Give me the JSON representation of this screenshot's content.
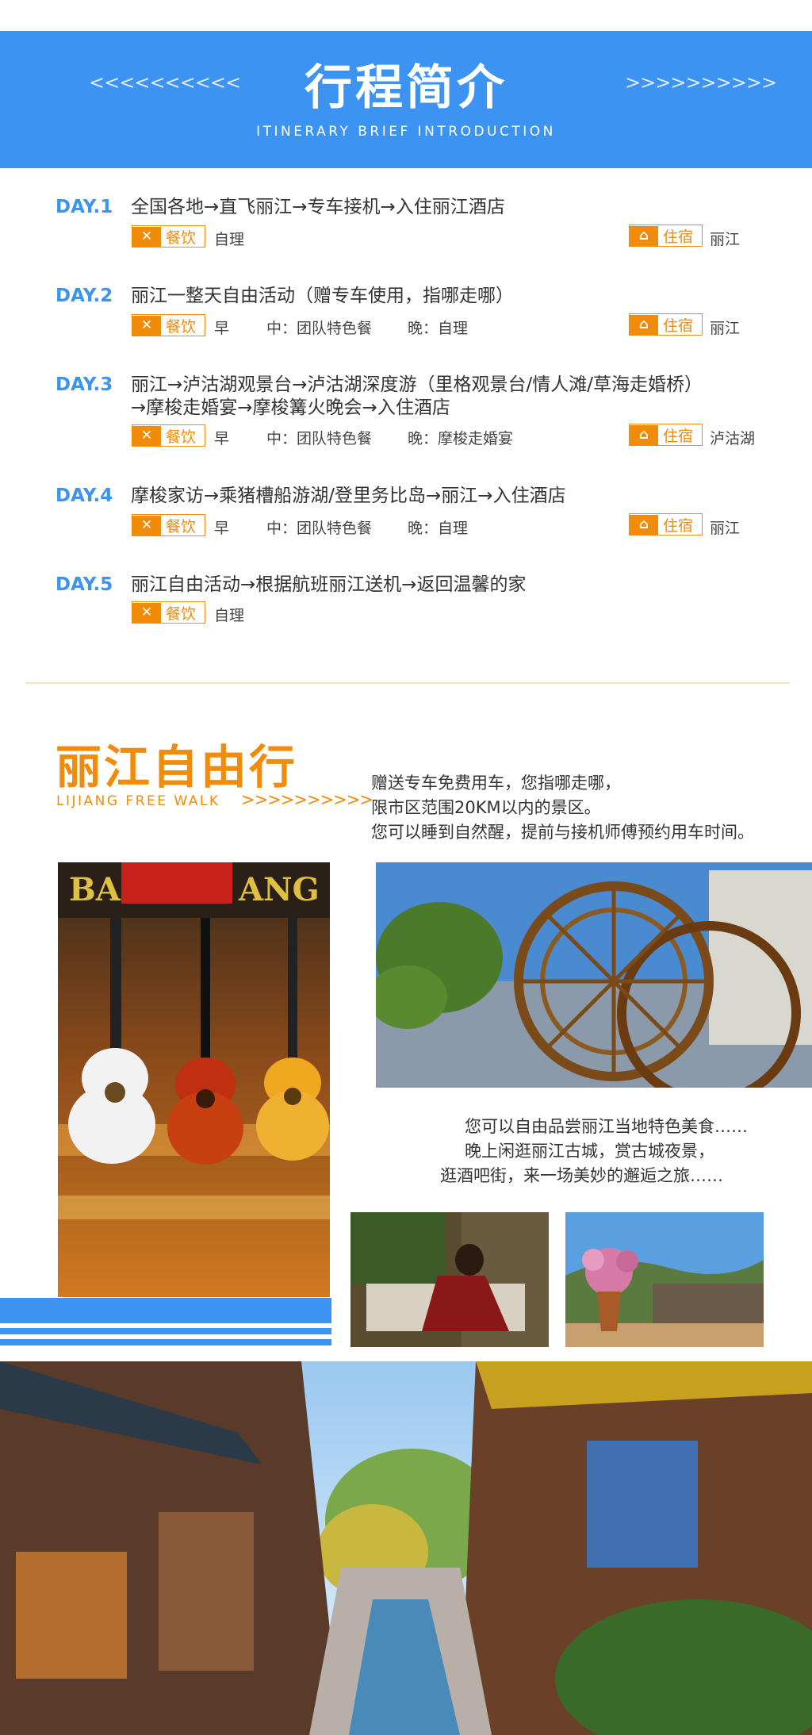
{
  "banner": {
    "title": "行程简介",
    "subtitle": "ITINERARY BRIEF INTRODUCTION",
    "left_arrows": "<<<<<<<<<<",
    "right_arrows": ">>>>>>>>>>"
  },
  "labels": {
    "meal": "餐饮",
    "stay": "住宿"
  },
  "days": [
    {
      "day": "DAY.1",
      "route": [
        "全国各地→直飞丽江→专车接机→入住丽江酒店"
      ],
      "meal": "自理",
      "lunch": "",
      "dinner": "",
      "stay": "丽江"
    },
    {
      "day": "DAY.2",
      "route": [
        "丽江一整天自由活动（赠专车使用，指哪走哪）"
      ],
      "meal": "早",
      "lunch": "中：团队特色餐",
      "dinner": "晚：自理",
      "stay": "丽江"
    },
    {
      "day": "DAY.3",
      "route": [
        "丽江→泸沽湖观景台→泸沽湖深度游（里格观景台/情人滩/草海走婚桥）",
        "→摩梭走婚宴→摩梭篝火晚会→入住酒店"
      ],
      "meal": "早",
      "lunch": "中：团队特色餐",
      "dinner": "晚：摩梭走婚宴",
      "stay": "泸沽湖"
    },
    {
      "day": "DAY.4",
      "route": [
        "摩梭家访→乘猪槽船游湖/登里务比岛→丽江→入住酒店"
      ],
      "meal": "早",
      "lunch": "中：团队特色餐",
      "dinner": "晚：自理",
      "stay": "丽江"
    },
    {
      "day": "DAY.5",
      "route": [
        "丽江自由活动→根据航班丽江送机→返回温馨的家"
      ],
      "meal": "自理",
      "lunch": "",
      "dinner": "",
      "stay": ""
    }
  ],
  "free_walk": {
    "title": "丽江自由行",
    "subtitle": "LIJIANG FREE WALK",
    "arrows": ">>>>>>>>>>",
    "desc": [
      "赠送专车免费用车，您指哪走哪，",
      "限市区范围20KM以内的景区。",
      "您可以睡到自然醒，提前与接机师傅预约用车时间。"
    ],
    "food_text": [
      "您可以自由品尝丽江当地特色美食……",
      "晚上闲逛丽江古城，赏古城夜景，",
      "逛酒吧街，来一场美妙的邂逅之旅……"
    ]
  },
  "photos": {
    "guitar_sign": "BA",
    "guitar_sign_right": "ANG"
  },
  "colors": {
    "blue": "#3d93f2",
    "orange": "#f08c0a"
  }
}
